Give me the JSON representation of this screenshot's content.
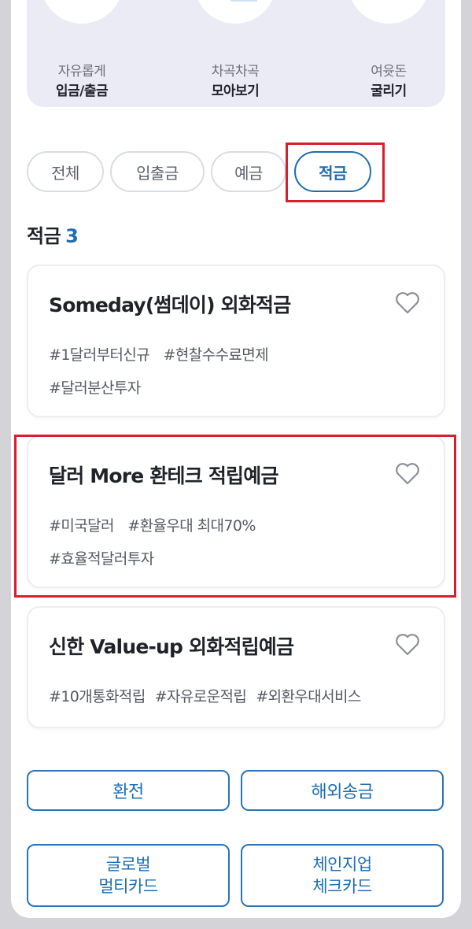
{
  "features": [
    {
      "icon": "wallet-icon",
      "line1": "자유롭게",
      "line2": "입금/출금"
    },
    {
      "icon": "coin-envelope-icon",
      "line1": "차곡차곡",
      "line2": "모아보기"
    },
    {
      "icon": "piggy-bank-icon",
      "line1": "여윳돈",
      "line2": "굴리기"
    }
  ],
  "filters": {
    "chips": [
      "전체",
      "입출금",
      "예금",
      "적금"
    ],
    "active": "적금"
  },
  "section": {
    "title": "적금",
    "count": "3"
  },
  "products": [
    {
      "name": "Someday(썸데이) 외화적금",
      "tags": [
        "#1달러부터신규",
        "#현찰수수료면제",
        "#달러분산투자"
      ]
    },
    {
      "name": "달러 More 환테크 적립예금",
      "tags": [
        "#미국달러",
        "#환율우대 최대70%",
        "#효율적달러투자"
      ]
    },
    {
      "name": "신한 Value-up 외화적립예금",
      "tags": [
        "#10개통화적립",
        "#자유로운적립",
        "#외환우대서비스"
      ]
    }
  ],
  "actions": [
    {
      "label": "환전"
    },
    {
      "label": "해외송금"
    },
    {
      "line1": "글로벌",
      "line2": "멀티카드"
    },
    {
      "line1": "체인지업",
      "line2": "체크카드"
    }
  ],
  "colors": {
    "accent": "#1e6db1",
    "highlight": "#d81e2c",
    "banner": "#ebebf6"
  }
}
